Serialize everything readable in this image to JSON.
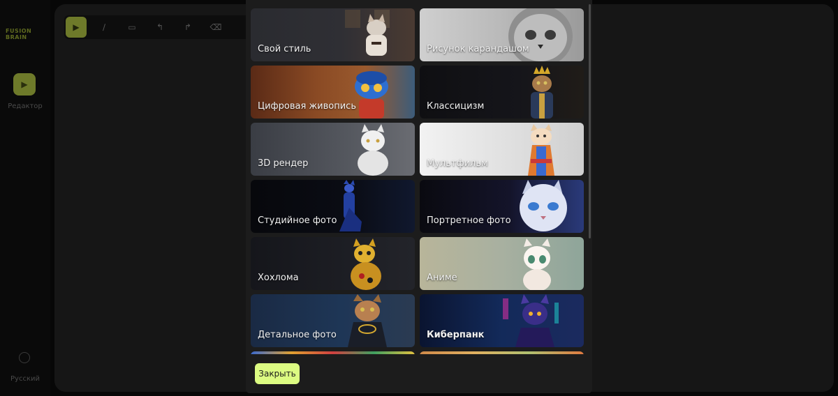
{
  "app": {
    "logo_text": "FUSION BRAIN",
    "sidebar": {
      "editor_label": "Редактор",
      "language_label": "Русский"
    }
  },
  "modal": {
    "styles": [
      {
        "label": "Свой стиль",
        "art": "kungfu-cat"
      },
      {
        "label": "Рисунок карандашом",
        "art": "pencil-cat"
      },
      {
        "label": "Цифровая живопись",
        "art": "digital-cat"
      },
      {
        "label": "Классицизм",
        "art": "crowned-cat"
      },
      {
        "label": "3D рендер",
        "art": "statue-cat"
      },
      {
        "label": "Мультфильм",
        "art": "cartoon-cat"
      },
      {
        "label": "Студийное фото",
        "art": "studio-cat"
      },
      {
        "label": "Портретное фото",
        "art": "portrait-cat"
      },
      {
        "label": "Хохлома",
        "art": "khokhloma-cat"
      },
      {
        "label": "Аниме",
        "art": "anime-cat"
      },
      {
        "label": "Детальное фото",
        "art": "detailed-cat"
      },
      {
        "label": "Киберпанк",
        "art": "cyberpunk-cat"
      },
      {
        "label": "",
        "art": "colorful-cat"
      },
      {
        "label": "",
        "art": "warm-cat"
      }
    ],
    "close_label": "Закрыть"
  },
  "colors": {
    "accent": "#dcfb82",
    "modal_bg": "#1c1c1c",
    "page_bg": "#070707"
  }
}
